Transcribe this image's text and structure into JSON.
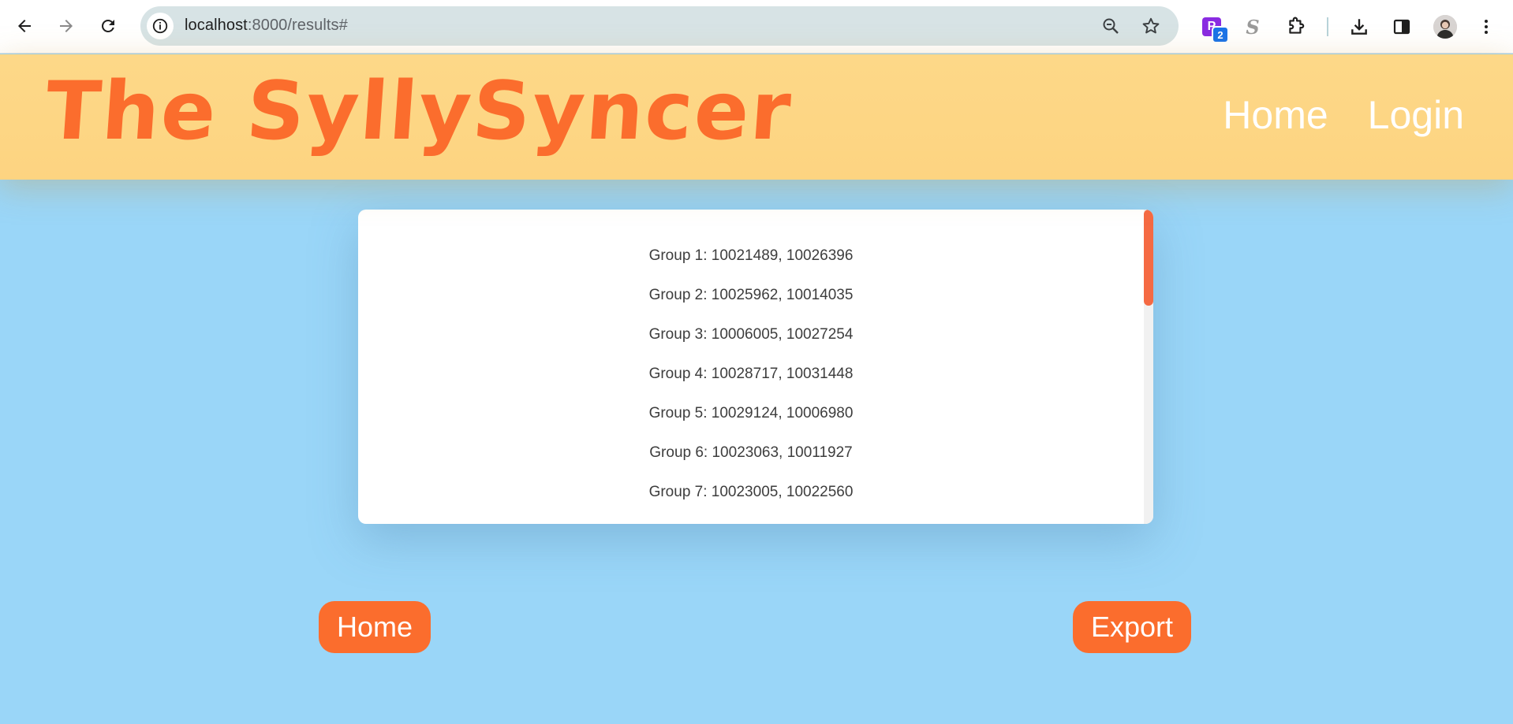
{
  "browser": {
    "url_host": "localhost",
    "url_path": ":8000/results#",
    "extension_badge": "2",
    "extension_p_label": "P",
    "extension_s_label": "S"
  },
  "header": {
    "brand": "The SyllySyncer",
    "nav": [
      {
        "label": "Home"
      },
      {
        "label": "Login"
      }
    ]
  },
  "results": {
    "groups": [
      "Group 1: 10021489, 10026396",
      "Group 2: 10025962, 10014035",
      "Group 3: 10006005, 10027254",
      "Group 4: 10028717, 10031448",
      "Group 5: 10029124, 10006980",
      "Group 6: 10023063, 10011927",
      "Group 7: 10023005, 10022560"
    ]
  },
  "actions": {
    "home_label": "Home",
    "export_label": "Export"
  },
  "colors": {
    "accent": "#fb6d2d",
    "header_bg": "#fdd888",
    "page_bg": "#9ad6f8"
  }
}
